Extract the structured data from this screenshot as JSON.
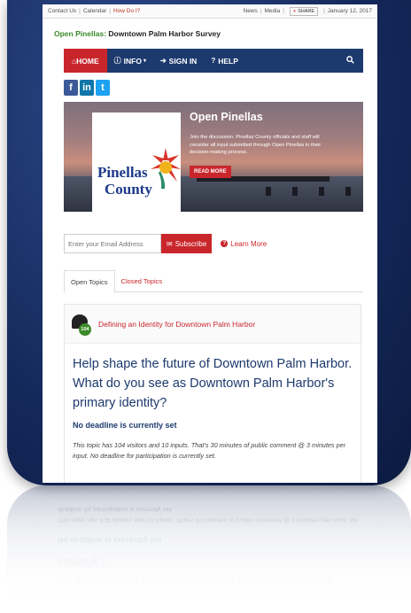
{
  "topbar": {
    "contact": "Contact Us",
    "calendar": "Calendar",
    "howdoi": "How Do I?",
    "news": "News",
    "media": "Media",
    "share": "SHARE",
    "date": "January 12, 2017"
  },
  "site": {
    "brand": "Open Pinellas:",
    "title": "Downtown Palm Harbor Survey"
  },
  "nav": {
    "home": "HOME",
    "info": "INFO",
    "signin": "SIGN IN",
    "help": "HELP"
  },
  "social": {
    "fb": "f",
    "li": "in",
    "tw": "t"
  },
  "hero": {
    "logo_line1": "Pinellas",
    "logo_line2": "County",
    "title": "Open Pinellas",
    "text": "Join the discussion. Pinellas County officials and staff will consider all input submitted through Open Pinellas in their decision-making process.",
    "readmore": "READ MORE"
  },
  "subscribe": {
    "placeholder": "Enter your Email Address",
    "button": "Subscribe",
    "learn": "Learn More"
  },
  "tabs": {
    "open": "Open Topics",
    "closed": "Closed Topics"
  },
  "topic": {
    "count": "104",
    "link": "Defining an Identity for Downtown Palm Harbor",
    "question": "Help shape the future of Downtown Palm Harbor. What do you see as Downtown Palm Harbor's primary identity?",
    "deadline": "No deadline is currently set",
    "stats": "This topic has 104 visitors and 10 inputs. That's 30 minutes of public comment @ 3 minutes per input. No deadline for participation is currently set."
  },
  "colors": {
    "navy": "#1d3a6e",
    "red": "#c9262c",
    "green": "#3a8a2a"
  }
}
